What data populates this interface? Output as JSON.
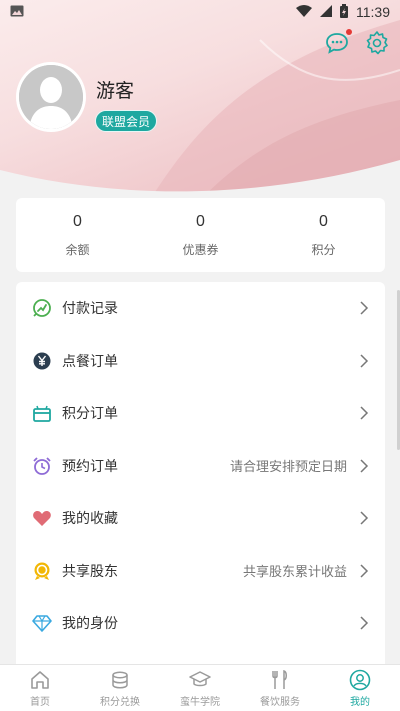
{
  "status_bar": {
    "time": "11:39"
  },
  "profile": {
    "name": "游客",
    "badge": "联盟会员"
  },
  "stats": [
    {
      "value": "0",
      "label": "余额"
    },
    {
      "value": "0",
      "label": "优惠券"
    },
    {
      "value": "0",
      "label": "积分"
    }
  ],
  "menu": [
    {
      "label": "付款记录",
      "hint": "",
      "icon": "payment-record-icon"
    },
    {
      "label": "点餐订单",
      "hint": "",
      "icon": "yen-icon"
    },
    {
      "label": "积分订单",
      "hint": "",
      "icon": "gift-icon"
    },
    {
      "label": "预约订单",
      "hint": "请合理安排预定日期",
      "icon": "alarm-clock-icon"
    },
    {
      "label": "我的收藏",
      "hint": "",
      "icon": "heart-icon"
    },
    {
      "label": "共享股东",
      "hint": "共享股东累计收益",
      "icon": "shareholder-icon"
    },
    {
      "label": "我的身份",
      "hint": "",
      "icon": "diamond-icon"
    }
  ],
  "tabs": [
    {
      "label": "首页",
      "icon": "home-icon"
    },
    {
      "label": "积分兑换",
      "icon": "coins-icon"
    },
    {
      "label": "蛮牛学院",
      "icon": "graduation-cap-icon"
    },
    {
      "label": "餐饮服务",
      "icon": "fork-knife-icon"
    },
    {
      "label": "我的",
      "icon": "user-icon"
    }
  ],
  "colors": {
    "accent": "#1ea8a0",
    "header_pink": "#f0c9cc",
    "notify_dot": "#e53935"
  }
}
